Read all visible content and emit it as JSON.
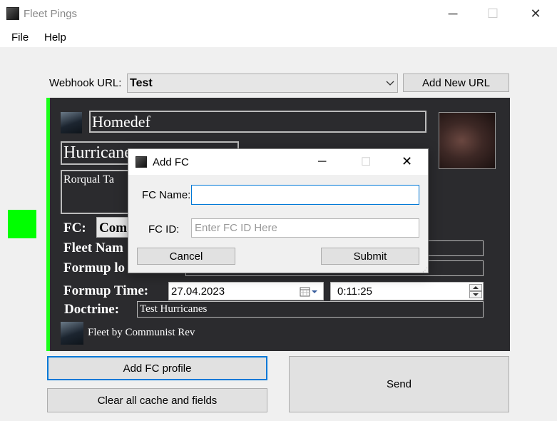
{
  "window": {
    "title": "Fleet Pings"
  },
  "menu": {
    "items": [
      "File",
      "Help"
    ]
  },
  "webhook": {
    "label": "Webhook URL:",
    "value": "Test",
    "add_button": "Add New URL"
  },
  "ping": {
    "title": "Homedef",
    "subtitle": "Hurricanes",
    "message_preview": "Rorqual Ta",
    "fc_label": "FC:",
    "fc_value": "Com",
    "fleet_name_label": "Fleet Nam",
    "formup_location_label": "Formup lo",
    "formup_time_label": "Formup Time:",
    "formup_date": "27.04.2023",
    "formup_clock": "0:11:25",
    "doctrine_label": "Doctrine:",
    "doctrine_value": "Test Hurricanes",
    "footer": "Fleet by Communist Rev"
  },
  "status_color": "#00ff00",
  "buttons": {
    "add_fc": "Add FC profile",
    "clear": "Clear all cache and fields",
    "send": "Send"
  },
  "dialog": {
    "title": "Add FC",
    "fc_name_label": "FC Name:",
    "fc_name_value": "",
    "fc_id_label": "FC ID:",
    "fc_id_placeholder": "Enter FC ID Here",
    "cancel": "Cancel",
    "submit": "Submit"
  }
}
